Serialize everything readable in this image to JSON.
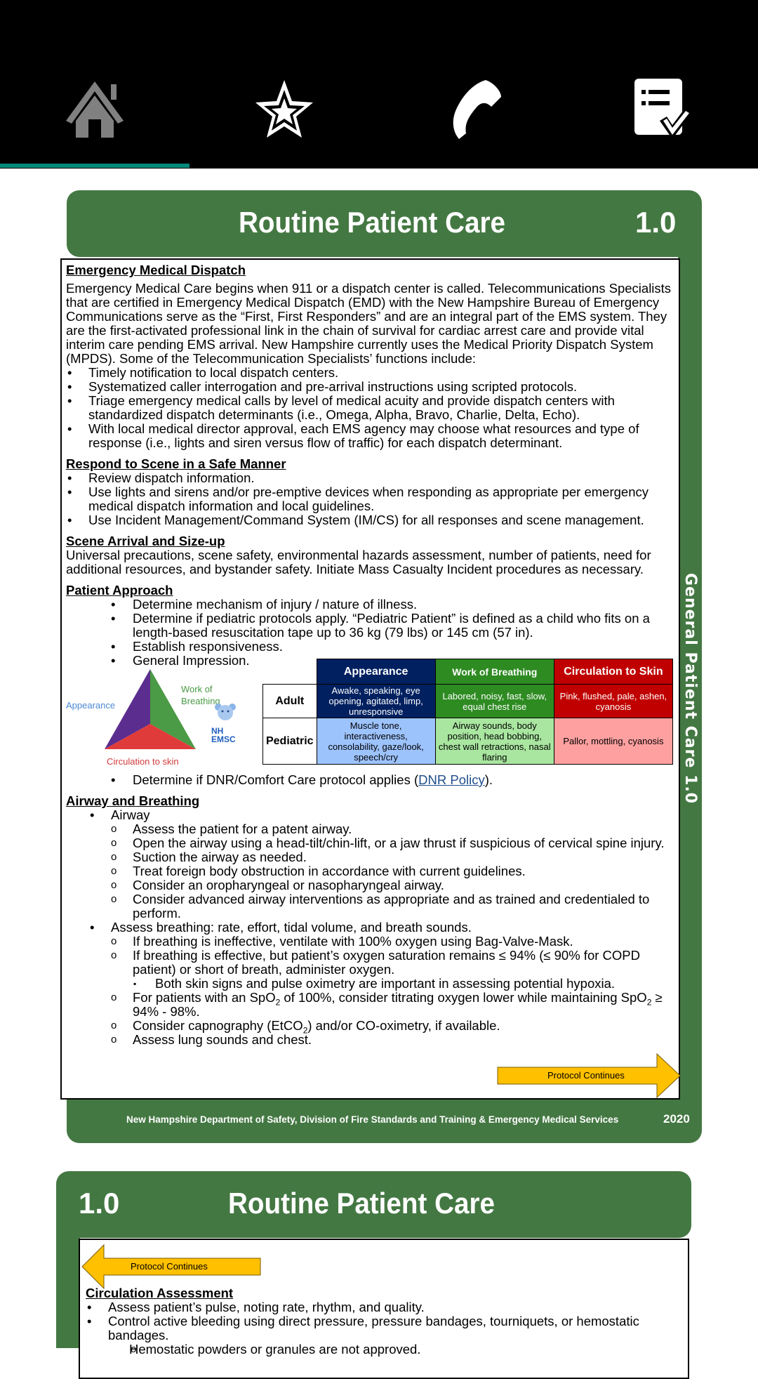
{
  "nav": {
    "tabs": [
      {
        "icon": "home-icon",
        "label": "Home",
        "active": true
      },
      {
        "icon": "star-icon",
        "label": "Favorites",
        "active": false
      },
      {
        "icon": "phone-icon",
        "label": "Contacts",
        "active": false
      },
      {
        "icon": "checklist-icon",
        "label": "Checklist",
        "active": false
      }
    ],
    "accent_color": "#00897b"
  },
  "page1": {
    "title": "Routine Patient Care",
    "number": "1.0",
    "sidebar": "General Patient Care   1.0",
    "sections": {
      "emd": {
        "heading": "Emergency Medical Dispatch",
        "paragraph": "Emergency Medical Care begins when 911 or a dispatch center is called.  Telecommunications Specialists that are certified in Emergency Medical Dispatch (EMD) with the New Hampshire Bureau of Emergency Communications serve as the “First, First Responders” and are an integral part of the EMS system. They are the first-activated professional link in the chain of survival for cardiac arrest care and provide vital interim care pending EMS arrival. New Hampshire currently uses the Medical Priority Dispatch System (MPDS).  Some of the Telecommunication Specialists’ functions include:",
        "bullets": [
          "Timely notification to local dispatch centers.",
          "Systematized caller interrogation and pre-arrival instructions using scripted protocols.",
          "Triage emergency medical calls by level of medical acuity and provide dispatch centers with standardized dispatch determinants (i.e., Omega, Alpha, Bravo, Charlie, Delta, Echo).",
          "With local medical director approval, each EMS agency may choose what resources and type of response (i.e., lights and siren versus flow of traffic) for each dispatch determinant."
        ]
      },
      "respond": {
        "heading": "Respond to Scene in a Safe Manner",
        "bullets": [
          "Review dispatch information.",
          "Use lights and sirens and/or pre-emptive devices when responding as appropriate per emergency medical dispatch information and local guidelines.",
          "Use Incident Management/Command System (IM/CS) for all responses and scene management."
        ]
      },
      "scene": {
        "heading": "Scene Arrival and Size-up",
        "paragraph": "Universal precautions, scene safety, environmental hazards assessment, number of patients, need for additional resources, and bystander safety. Initiate Mass Casualty Incident procedures as necessary."
      },
      "approach": {
        "heading": "Patient Approach",
        "bullets": [
          "Determine mechanism of injury / nature of illness.",
          "Determine if pediatric protocols apply. “Pediatric Patient” is defined as a child who fits on a length-based resuscitation tape up to 36 kg (79 lbs) or 145 cm (57 in).",
          "Establish responsiveness.",
          "General Impression."
        ],
        "dnr_text": "Determine if DNR/Comfort Care protocol applies (",
        "dnr_link": "DNR Policy",
        "dnr_end": ").",
        "triangle": {
          "appearance": "Appearance",
          "work": "Work of Breathing",
          "work_l1": "Work of",
          "work_l2": "Breathing",
          "circulation": "Circulation to skin"
        },
        "badge": {
          "l1": "NH",
          "l2": "EMSC"
        },
        "table": {
          "headers": [
            "Appearance",
            "Work of Breathing",
            "Circulation to Skin"
          ],
          "rows": [
            {
              "label": "Adult",
              "cells": [
                "Awake, speaking, eye opening, agitated, limp, unresponsive",
                "Labored, noisy, fast, slow, equal chest rise",
                "Pink, flushed, pale, ashen, cyanosis"
              ]
            },
            {
              "label": "Pediatric",
              "cells": [
                "Muscle tone, interactiveness, consolability, gaze/look, speech/cry",
                "Airway sounds, body position, head bobbing, chest wall retractions, nasal flaring",
                "Pallor, mottling, cyanosis"
              ]
            }
          ]
        }
      },
      "airway": {
        "heading": "Airway and Breathing",
        "airway_label": "Airway",
        "airway_items": [
          "Assess the patient for a patent airway.",
          "Open the airway using a head-tilt/chin-lift, or a jaw thrust if suspicious of cervical spine injury.",
          "Suction the airway as needed.",
          "Treat foreign body obstruction in accordance with current guidelines.",
          "Consider an oropharyngeal or nasopharyngeal airway.",
          "Consider advanced airway interventions as appropriate and as trained and credentialed to perform."
        ],
        "breathing_label": "Assess breathing: rate, effort, tidal volume, and breath sounds.",
        "breathing_items": {
          "i1": "If breathing is ineffective, ventilate with 100% oxygen using Bag-Valve-Mask.",
          "i2": "If breathing is effective, but patient’s oxygen saturation remains ≤ 94% (≤ 90% for COPD patient) or short of breath, administer oxygen.",
          "i2_sub": "Both skin signs and pulse oximetry are important in assessing potential hypoxia.",
          "i3_a": "For patients with an SpO",
          "i3_b": " of 100%, consider titrating oxygen lower while maintaining SpO",
          "i3_c": " ≥ 94% - 98%.",
          "sub2": "2",
          "i4_a": "Consider capnography (EtCO",
          "i4_b": ") and/or CO-oximetry, if available.",
          "i5": "Assess lung sounds and chest."
        }
      }
    },
    "continue_label": "Protocol Continues",
    "footer": "New Hampshire Department of Safety, Division of Fire Standards and Training & Emergency Medical Services",
    "year": "2020"
  },
  "page2": {
    "number": "1.0",
    "title": "Routine Patient Care",
    "continue_label": "Protocol Continues",
    "circulation": {
      "heading": "Circulation Assessment",
      "bullets": [
        "Assess patient’s pulse, noting rate, rhythm, and quality.",
        "Control active bleeding using direct pressure, pressure bandages, tourniquets, or hemostatic bandages."
      ],
      "sub": "Hemostatic powders or granules are not approved."
    }
  },
  "colors": {
    "header_green": "#447843",
    "appearance_dark": "#002060",
    "appearance_light": "#9dc3fd",
    "work_dark": "#2e8b22",
    "work_light": "#a9e6a0",
    "circ_dark": "#c00000",
    "circ_light": "#ffa0a0",
    "arrow_yellow": "#ffc000"
  }
}
